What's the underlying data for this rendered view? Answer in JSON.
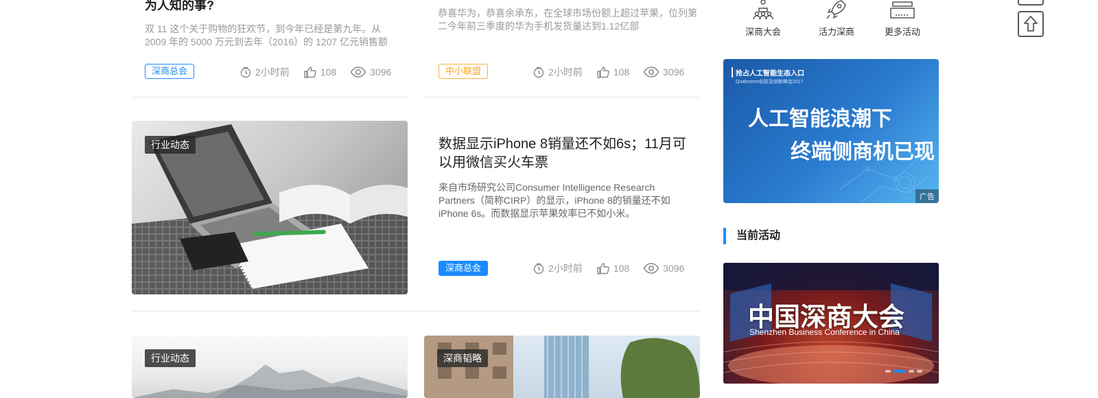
{
  "articles": [
    {
      "title": "为人知的事?",
      "excerpt": "双 11 这个关于购物的狂欢节，到今年已经是第九年。从 2009 年的 5000 万元到去年（2016）的 1207 亿元销售额",
      "tag": "深商总会",
      "time": "2小时前",
      "likes": "108",
      "views": "3096"
    },
    {
      "excerpt": "恭喜华为，恭喜余承东，在全球市场份额上超过苹果，位列第二今年前三季度的华为手机发货量达到1.12亿部",
      "tag": "中小联盟",
      "time": "2小时前",
      "likes": "108",
      "views": "3096"
    },
    {
      "category": "行业动态",
      "title": "数据显示iPhone 8销量还不如6s；11月可以用微信买火车票",
      "excerpt": "来自市场研究公司Consumer Intelligence Research Partners（简称CIRP）的显示，iPhone 8的销量还不如iPhone 6s。而数据显示苹果效率已不如小米。",
      "tag": "深商总会",
      "time": "2小时前",
      "likes": "108",
      "views": "3096"
    },
    {
      "category": "行业动态"
    },
    {
      "category": "深商韬略"
    }
  ],
  "sidebar": {
    "quick_links": [
      {
        "label": "深商大会",
        "icon": "conference-icon"
      },
      {
        "label": "活力深商",
        "icon": "rocket-icon"
      },
      {
        "label": "更多活动",
        "icon": "more-activities-icon"
      }
    ],
    "ad": {
      "small_title": "抢占人工智能生态入口",
      "subtitle": "Qualcomm创投及创新峰会2017",
      "line1": "人工智能浪潮下",
      "line2": "终端侧商机已现",
      "badge": "广告"
    },
    "section_title": "当前活动",
    "event": {
      "title": "中国深商大会",
      "subtitle": "Shenzhen Business Conference in China"
    }
  },
  "colors": {
    "accent": "#1a8cff",
    "orange": "#f5a623"
  }
}
